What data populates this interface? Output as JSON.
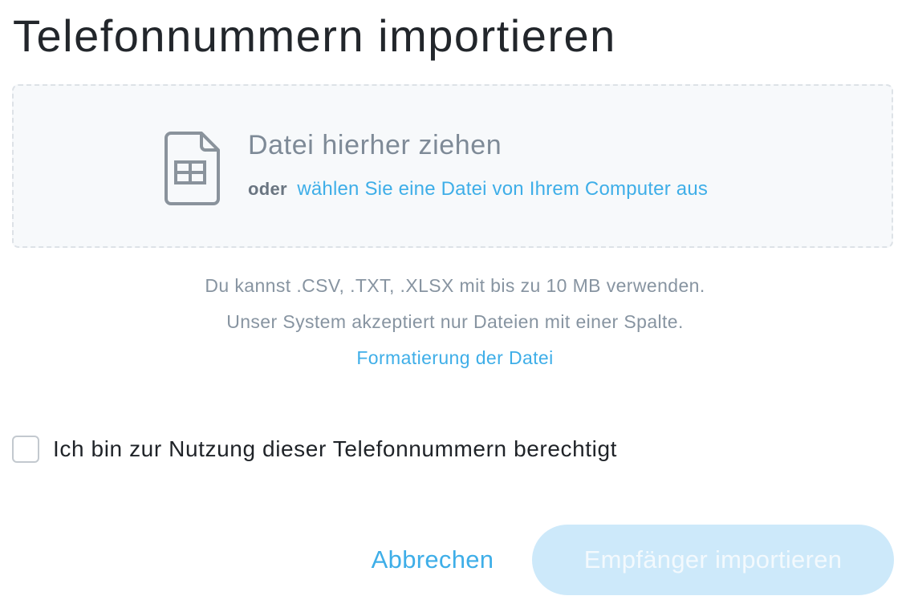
{
  "dialog": {
    "title": "Telefonnummern importieren"
  },
  "dropzone": {
    "icon": "spreadsheet-file-icon",
    "title": "Datei hierher ziehen",
    "or_label": "oder",
    "choose_link": "wählen Sie eine Datei von Ihrem Computer aus"
  },
  "info": {
    "line1": "Du kannst .CSV, .TXT, .XLSX mit bis zu 10 MB verwenden.",
    "line2": "Unser System akzeptiert nur Dateien mit einer Spalte.",
    "format_link": "Formatierung der Datei"
  },
  "consent": {
    "label": "Ich bin zur Nutzung dieser Telefonnummern berechtigt",
    "checked": false
  },
  "actions": {
    "cancel_label": "Abbrechen",
    "import_label": "Empfänger importieren",
    "import_enabled": false
  },
  "colors": {
    "accent": "#3eaee8",
    "disabled_button": "#cde9fa",
    "dropzone_bg": "#f7f9fb",
    "muted_text": "#8794a1"
  }
}
